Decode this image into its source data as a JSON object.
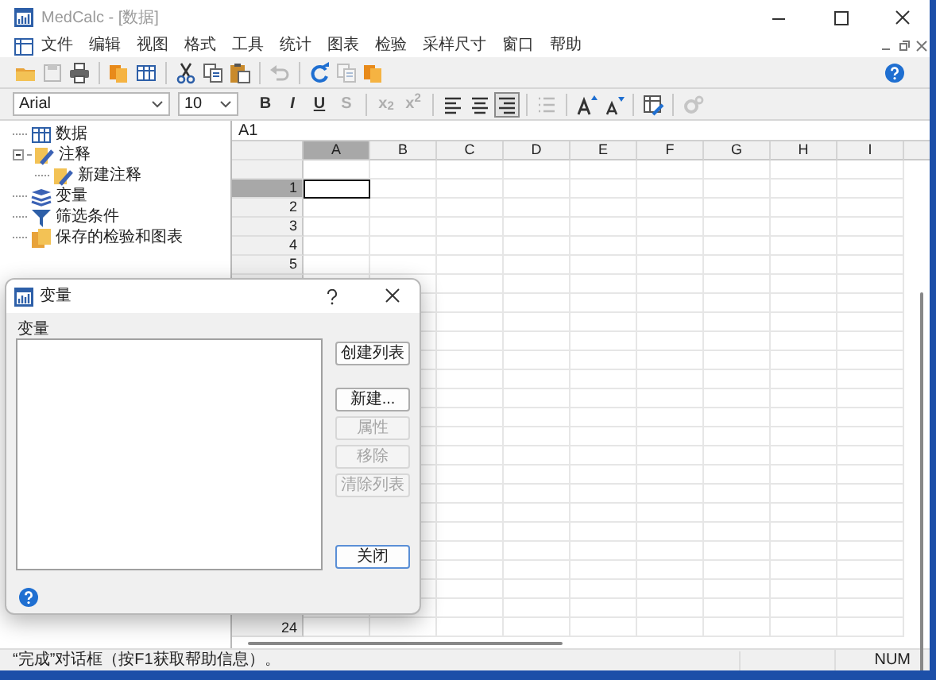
{
  "window": {
    "title": "MedCalc - [数据]",
    "active": false
  },
  "menu": {
    "items": [
      "文件",
      "编辑",
      "视图",
      "格式",
      "工具",
      "统计",
      "图表",
      "检验",
      "采样尺寸",
      "窗口",
      "帮助"
    ]
  },
  "toolbar": [
    {
      "kind": "folder",
      "disabled": false
    },
    {
      "kind": "floppy",
      "disabled": true
    },
    {
      "kind": "printer",
      "disabled": false
    },
    {
      "kind": "separator"
    },
    {
      "kind": "pages",
      "disabled": false
    },
    {
      "kind": "table",
      "disabled": false
    },
    {
      "kind": "separator"
    },
    {
      "kind": "scissors",
      "disabled": false
    },
    {
      "kind": "copy",
      "disabled": false
    },
    {
      "kind": "paste",
      "disabled": false
    },
    {
      "kind": "separator"
    },
    {
      "kind": "undo",
      "disabled": true
    },
    {
      "kind": "separator"
    },
    {
      "kind": "refresh",
      "disabled": false
    },
    {
      "kind": "copy",
      "disabled": true
    },
    {
      "kind": "pages",
      "disabled": false
    }
  ],
  "format_bar": {
    "font": "Arial",
    "size": "10",
    "buttons": [
      {
        "kind": "text",
        "label": "B",
        "disabled": false,
        "pressed": false
      },
      {
        "kind": "text",
        "label": "I",
        "disabled": false,
        "pressed": false
      },
      {
        "kind": "text",
        "label": "U",
        "disabled": false,
        "pressed": false
      },
      {
        "kind": "text",
        "label": "S",
        "disabled": true,
        "pressed": false
      },
      {
        "kind": "separator"
      },
      {
        "kind": "text",
        "label": "x$_{2}$",
        "disabled": true,
        "pressed": false
      },
      {
        "kind": "text",
        "label": "x$^{2}$",
        "disabled": true,
        "pressed": false
      },
      {
        "kind": "separator"
      },
      {
        "kind": "align-left",
        "disabled": false,
        "pressed": false
      },
      {
        "kind": "align-center",
        "disabled": false,
        "pressed": false
      },
      {
        "kind": "align-right",
        "disabled": false,
        "pressed": true
      },
      {
        "kind": "separator"
      },
      {
        "kind": "list",
        "disabled": true,
        "pressed": false
      },
      {
        "kind": "separator"
      },
      {
        "kind": "grow",
        "disabled": false,
        "pressed": false
      },
      {
        "kind": "shrink",
        "disabled": false,
        "pressed": false
      },
      {
        "kind": "separator"
      },
      {
        "kind": "table-edit",
        "disabled": false,
        "pressed": false
      },
      {
        "kind": "separator"
      },
      {
        "kind": "gear",
        "disabled": true,
        "pressed": false
      }
    ]
  },
  "tree": [
    {
      "label": "数据",
      "kind": "table"
    },
    {
      "label": "注释",
      "kind": "note",
      "expanded": true,
      "children": [
        {
          "label": "新建注释",
          "kind": "note"
        }
      ]
    },
    {
      "label": "变量",
      "kind": "variables"
    },
    {
      "label": "筛选条件",
      "kind": "filter"
    },
    {
      "label": "保存的检验和图表",
      "kind": "saved"
    }
  ],
  "spreadsheet": {
    "cell_ref": "A1",
    "columns": [
      {
        "label": "A",
        "selected": true
      },
      {
        "label": "B",
        "selected": false
      },
      {
        "label": "C",
        "selected": false
      },
      {
        "label": "D",
        "selected": false
      },
      {
        "label": "E",
        "selected": false
      },
      {
        "label": "F",
        "selected": false
      },
      {
        "label": "G",
        "selected": false
      },
      {
        "label": "H",
        "selected": false
      },
      {
        "label": "I",
        "selected": false
      }
    ],
    "rows": [
      {
        "label": "1",
        "selected": true
      },
      {
        "label": "2",
        "selected": false
      },
      {
        "label": "3",
        "selected": false
      },
      {
        "label": "4",
        "selected": false
      },
      {
        "label": "5",
        "selected": false
      }
    ],
    "bottom_row": {
      "label": "24",
      "selected": false
    }
  },
  "dialog": {
    "title": "变量",
    "list_label": "变量",
    "buttons": [
      {
        "label": "创建列表",
        "disabled": false
      },
      {
        "label": "新建...",
        "disabled": false
      },
      {
        "label": "属性",
        "disabled": true
      },
      {
        "label": "移除",
        "disabled": true
      },
      {
        "label": "清除列表",
        "disabled": true
      },
      {
        "label": "关闭",
        "disabled": false
      }
    ]
  },
  "status_bar": {
    "message": "“完成”对话框（按F1获取帮助信息）。",
    "indicator": "NUM"
  }
}
